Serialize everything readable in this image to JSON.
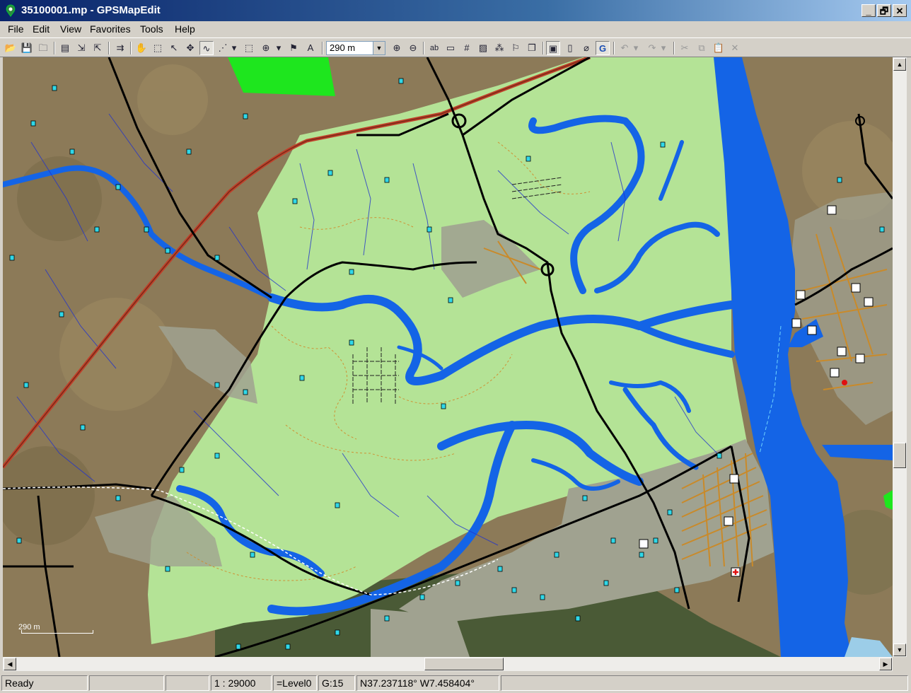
{
  "window": {
    "title": "35100001.mp - GPSMapEdit",
    "buttons": [
      "_",
      "🗗",
      "✕"
    ]
  },
  "menu": [
    "File",
    "Edit",
    "View",
    "Favorites",
    "Tools",
    "Help"
  ],
  "toolbar": {
    "zoom_value": "290 m",
    "icons": [
      "open-icon",
      "save-icon",
      "save-as-icon",
      "properties-icon",
      "import-icon",
      "export-icon",
      "transfer-icon",
      "pan-icon",
      "zoom-rect-icon",
      "select-icon",
      "move-icon",
      "edit-nodes-icon",
      "create-line-icon",
      "dropdown-icon",
      "select-area-icon",
      "crosshair-icon",
      "dropdown-icon",
      "track-icon",
      "label-icon"
    ]
  },
  "map": {
    "scale_label": "290 m",
    "colors": {
      "land": "#b4e396",
      "water": "#1464e6",
      "urban": "#a0a290",
      "park": "#1ee61e",
      "road": "#000000",
      "highway": "#c0402a",
      "satellite": "#8c7a58"
    }
  },
  "status": {
    "ready": "Ready",
    "scale": "1 : 29000",
    "level": "=Level0",
    "grid": "G:15",
    "coords": "N37.237118° W7.458404°"
  }
}
